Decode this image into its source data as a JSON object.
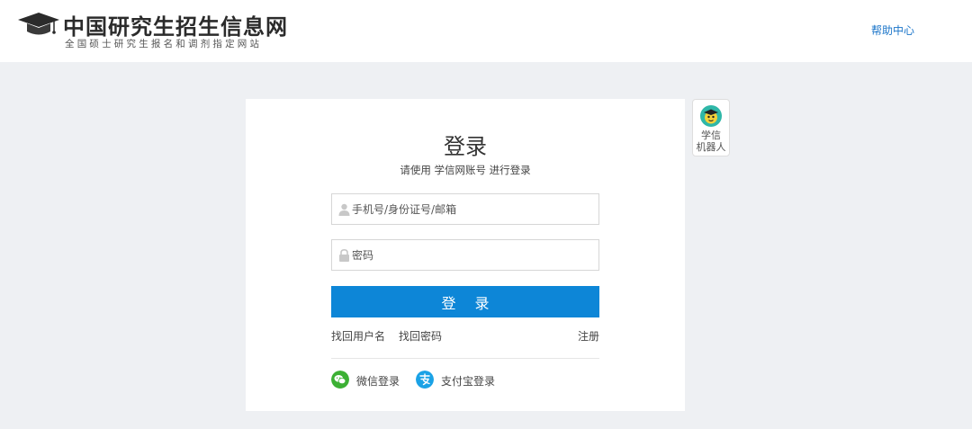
{
  "header": {
    "logo_title": "中国研究生招生信息网",
    "logo_subtitle": "全国硕士研究生报名和调剂指定网站",
    "help_link": "帮助中心"
  },
  "login": {
    "title": "登录",
    "subtitle": "请使用 学信网账号 进行登录",
    "username_placeholder": "手机号/身份证号/邮箱",
    "password_placeholder": "密码",
    "submit_label": "登 录",
    "find_username": "找回用户名",
    "find_password": "找回密码",
    "register": "注册",
    "wechat_label": "微信登录",
    "alipay_label": "支付宝登录"
  },
  "robot": {
    "label_line1": "学信",
    "label_line2": "机器人"
  },
  "icons": {
    "logo": "graduation-cap-icon",
    "username": "user-icon",
    "password": "lock-icon",
    "wechat": "wechat-icon",
    "alipay": "alipay-icon",
    "robot": "robot-avatar-icon"
  },
  "colors": {
    "accent": "#0d86d7",
    "link": "#1b75c9",
    "background": "#eef0f3",
    "wechat": "#3cb034",
    "alipay": "#1aa2e6"
  }
}
